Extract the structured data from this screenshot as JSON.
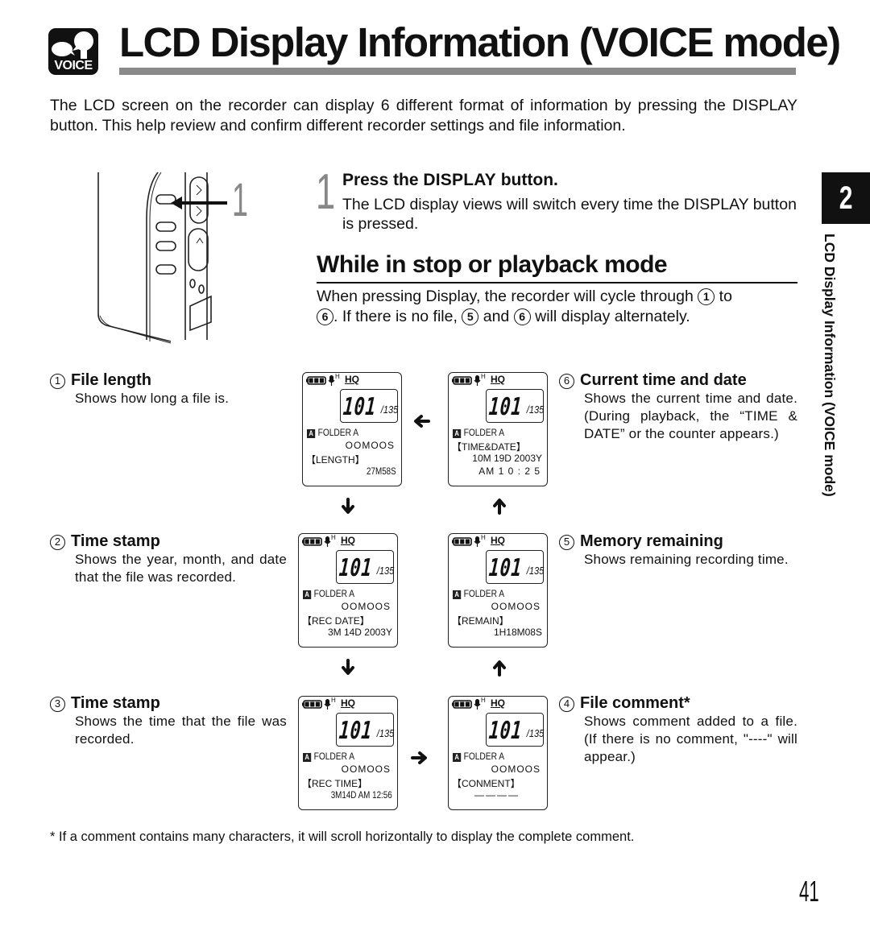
{
  "header": {
    "badge_label": "VOICE",
    "badge_icon": "voice-speaking-icon",
    "title": "LCD Display Information (VOICE mode)"
  },
  "intro": "The LCD screen on the recorder can display 6 different format of information by pressing the DISPLAY button. This help review and confirm different recorder settings and file information.",
  "device": {
    "callout_number": "1",
    "icon": "voice-recorder-illustration"
  },
  "step": {
    "number": "1",
    "heading_prefix": "Press the ",
    "heading_key": "DISPLAY",
    "heading_suffix": " button.",
    "body": "The LCD display views will switch every time the DISPLAY button is pressed."
  },
  "section": {
    "heading": "While in stop or playback mode",
    "body_parts": [
      "When pressing Display, the recorder will cycle through ",
      "1",
      " to ",
      "6",
      ". If there is no file, ",
      "5",
      " and ",
      "6",
      " will display alternately."
    ]
  },
  "items": [
    {
      "num": "1",
      "title": "File length",
      "desc": "Shows how long a file is."
    },
    {
      "num": "2",
      "title": "Time stamp",
      "desc": "Shows the year, month, and date that the file was recorded."
    },
    {
      "num": "3",
      "title": "Time stamp",
      "desc": "Shows the time that the file was recorded."
    },
    {
      "num": "4",
      "title": "File comment*",
      "desc": "Shows comment added to a file. (If there is no comment, \"----\" will appear.)"
    },
    {
      "num": "5",
      "title": "Memory remaining",
      "desc": "Shows remaining recording time."
    },
    {
      "num": "6",
      "title": "Current time and date",
      "desc": "Shows the current time and date. (During playback, the “TIME & DATE” or the counter appears.)"
    }
  ],
  "lcd_common": {
    "quality": "HQ",
    "mic_sensitivity": "H",
    "file_number": "101",
    "total_files": "/135",
    "folder_letter": "A",
    "folder_label": "FOLDER A",
    "filename": "OOMOOS",
    "battery_level": 3,
    "battery_max": 3
  },
  "lcds": [
    {
      "id": "1",
      "label": "【LENGTH】",
      "value": "27M58S"
    },
    {
      "id": "2",
      "label": "【REC DATE】",
      "value": "3M 14D 2003Y"
    },
    {
      "id": "3",
      "label": "【REC TIME】",
      "value": "3M14D AM 12:56"
    },
    {
      "id": "4",
      "label": "【CONMENT】",
      "value": "————"
    },
    {
      "id": "5",
      "label": "【REMAIN】",
      "value": "1H18M08S"
    },
    {
      "id": "6",
      "label": "【TIME&DATE】",
      "value": "10M 19D 2003Y",
      "value2": "AM 1 0 : 2 5"
    }
  ],
  "side": {
    "chapter": "2",
    "title": "LCD Display Information (VOICE mode)"
  },
  "footnote": "*  If a comment contains many characters, it will scroll horizontally to display the complete comment.",
  "page_number": "41"
}
